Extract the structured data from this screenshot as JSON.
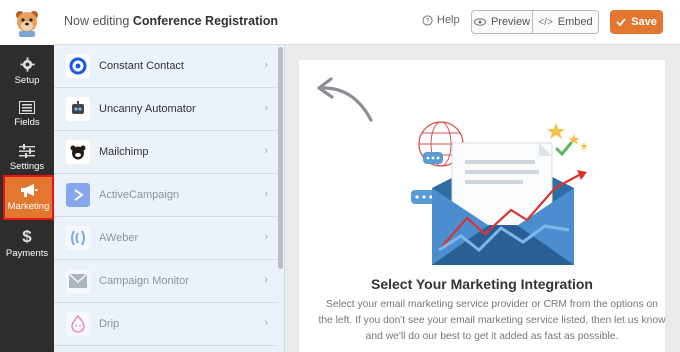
{
  "header": {
    "title_prefix": "Now editing",
    "form_name": "Conference Registration",
    "help_label": "Help",
    "preview_label": "Preview",
    "embed_label": "Embed",
    "save_label": "Save"
  },
  "sidebar": {
    "items": [
      {
        "label": "Setup",
        "icon": "gear-icon"
      },
      {
        "label": "Fields",
        "icon": "list-icon"
      },
      {
        "label": "Settings",
        "icon": "sliders-icon"
      },
      {
        "label": "Marketing",
        "icon": "megaphone-icon",
        "active": true
      },
      {
        "label": "Payments",
        "icon": "dollar-icon"
      }
    ]
  },
  "integrations": [
    {
      "label": "Constant Contact",
      "enabled": true
    },
    {
      "label": "Uncanny Automator",
      "enabled": true
    },
    {
      "label": "Mailchimp",
      "enabled": true
    },
    {
      "label": "ActiveCampaign",
      "enabled": false
    },
    {
      "label": "AWeber",
      "enabled": false
    },
    {
      "label": "Campaign Monitor",
      "enabled": false
    },
    {
      "label": "Drip",
      "enabled": false
    }
  ],
  "main": {
    "heading": "Select Your Marketing Integration",
    "description": "Select your email marketing service provider or CRM from the options on the left. If you don't see your email marketing service listed, then let us know and we'll do our best to get it added as fast as possible."
  },
  "colors": {
    "accent": "#e27730",
    "sidebar_bg": "#2d2d2d",
    "list_bg": "#ebf2fa",
    "active_outline": "#e11111"
  }
}
